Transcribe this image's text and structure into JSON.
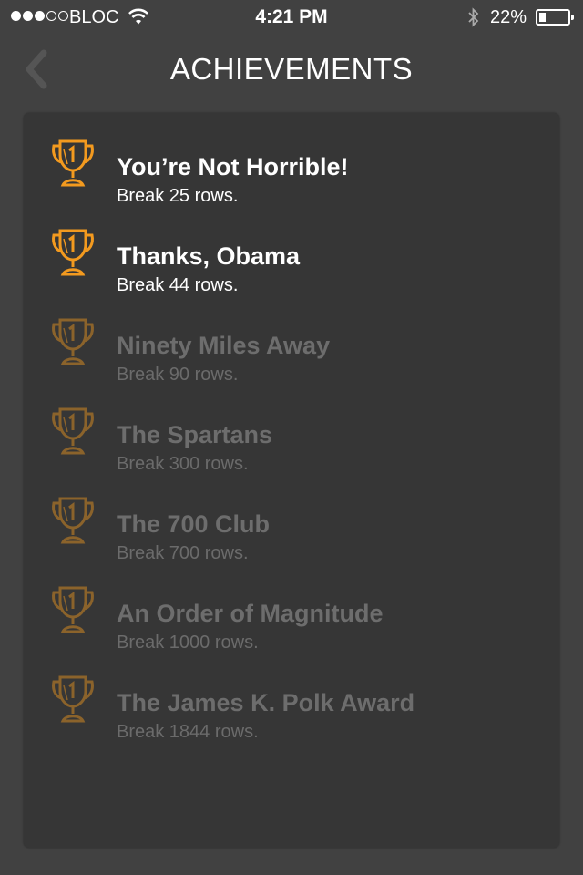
{
  "status_bar": {
    "carrier": "BLOC",
    "signal_bars_on": 3,
    "signal_bars_total": 5,
    "time": "4:21 PM",
    "battery_percent": "22%",
    "battery_level": 0.22,
    "icons": [
      "wifi-icon",
      "bluetooth-icon",
      "battery-icon"
    ]
  },
  "nav": {
    "title": "ACHIEVEMENTS",
    "back_icon": "chevron-left-icon"
  },
  "colors": {
    "background": "#414141",
    "panel": "#363636",
    "trophy": "#f39a1f",
    "locked_text": "#6d6d6d"
  },
  "achievements": [
    {
      "name": "You’re Not Horrible!",
      "description": "Break 25 rows.",
      "unlocked": true
    },
    {
      "name": "Thanks, Obama",
      "description": "Break 44 rows.",
      "unlocked": true
    },
    {
      "name": "Ninety Miles Away",
      "description": "Break 90 rows.",
      "unlocked": false
    },
    {
      "name": "The Spartans",
      "description": "Break 300 rows.",
      "unlocked": false
    },
    {
      "name": "The 700 Club",
      "description": "Break 700 rows.",
      "unlocked": false
    },
    {
      "name": "An Order of Magnitude",
      "description": "Break 1000 rows.",
      "unlocked": false
    },
    {
      "name": "The James K. Polk Award",
      "description": "Break 1844 rows.",
      "unlocked": false
    }
  ]
}
